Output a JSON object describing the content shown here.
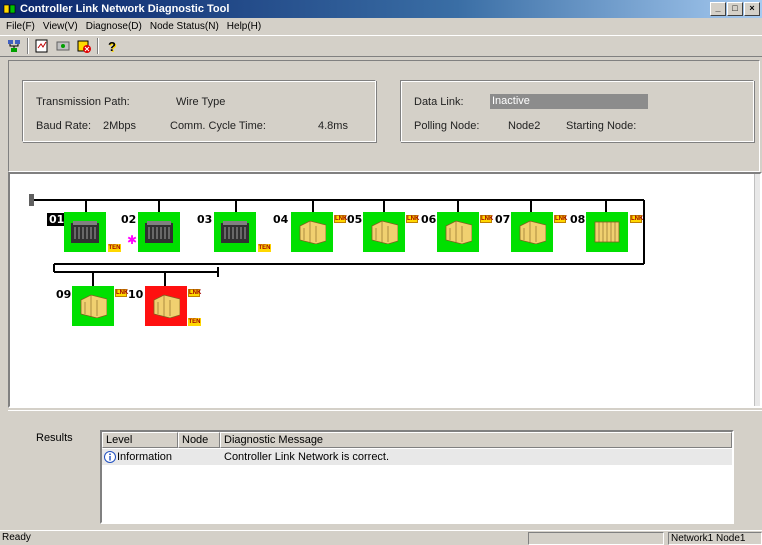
{
  "window": {
    "title": "Controller Link Network Diagnostic Tool"
  },
  "menu": [
    "File(F)",
    "View(V)",
    "Diagnose(D)",
    "Node Status(N)",
    "Help(H)"
  ],
  "toolbar": {
    "icons": [
      "network-icon",
      "diagnose-icon",
      "node-status-icon",
      "stop-icon",
      "help-icon"
    ],
    "help_glyph": "?"
  },
  "info": {
    "transmission_path_label": "Transmission Path:",
    "transmission_path_value": "Wire Type",
    "baud_rate_label": "Baud Rate:",
    "baud_rate_value": "2Mbps",
    "comm_cycle_label": "Comm. Cycle Time:",
    "comm_cycle_value": "4.8ms",
    "data_link_label": "Data Link:",
    "data_link_value": "Inactive",
    "polling_node_label": "Polling Node:",
    "polling_node_value": "Node2",
    "starting_node_label": "Starting Node:"
  },
  "network": {
    "nodes": [
      {
        "num": "01",
        "type": "dark",
        "status": "ok",
        "selected": true,
        "lnk": false,
        "ten": true
      },
      {
        "num": "02",
        "type": "dark",
        "status": "ok",
        "selected": false,
        "lnk": false,
        "ten": false,
        "star": true
      },
      {
        "num": "03",
        "type": "dark",
        "status": "ok",
        "selected": false,
        "lnk": false,
        "ten": true
      },
      {
        "num": "04",
        "type": "tan",
        "status": "ok",
        "selected": false,
        "lnk": true,
        "ten": false
      },
      {
        "num": "05",
        "type": "tan",
        "status": "ok",
        "selected": false,
        "lnk": true,
        "ten": false
      },
      {
        "num": "06",
        "type": "tan",
        "status": "ok",
        "selected": false,
        "lnk": true,
        "ten": false
      },
      {
        "num": "07",
        "type": "tan",
        "status": "ok",
        "selected": false,
        "lnk": true,
        "ten": false
      },
      {
        "num": "08",
        "type": "tan",
        "status": "ok",
        "selected": false,
        "lnk": true,
        "ten": false
      },
      {
        "num": "09",
        "type": "tan",
        "status": "ok",
        "selected": false,
        "lnk": true,
        "ten": false
      },
      {
        "num": "10",
        "type": "tan",
        "status": "error",
        "selected": false,
        "lnk": true,
        "ten": true
      }
    ],
    "badges": {
      "lnk": "LNK",
      "ten": "TEN"
    },
    "colors": {
      "ok": "#00e000",
      "error": "#ff1010"
    }
  },
  "results": {
    "label": "Results",
    "columns": [
      "Level",
      "Node",
      "Diagnostic Message"
    ],
    "rows": [
      {
        "level": "Information",
        "node": "",
        "message": "Controller Link Network is correct."
      }
    ]
  },
  "statusbar": {
    "text": "Ready",
    "network_node": "Network1 Node1"
  }
}
